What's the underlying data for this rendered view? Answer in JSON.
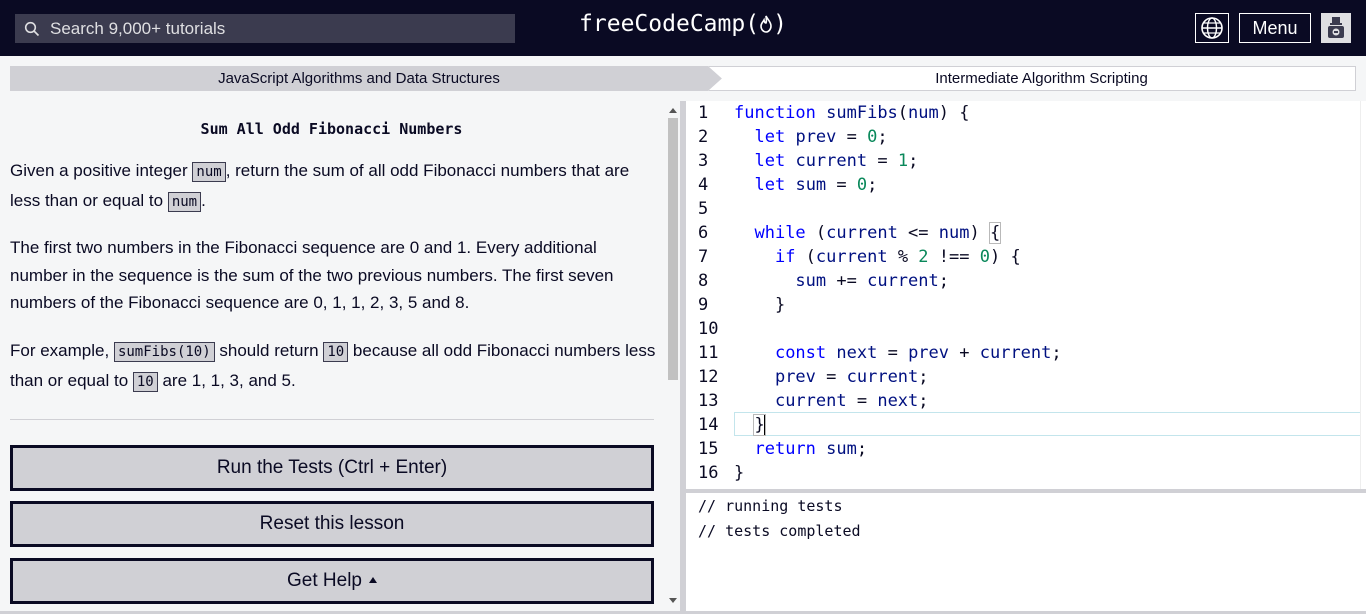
{
  "nav": {
    "search_placeholder": "Search 9,000+ tutorials",
    "brand": "freeCodeCamp(🔥)",
    "brand_text": "freeCodeCamp",
    "menu_label": "Menu",
    "globe_icon": "globe-icon",
    "avatar_icon": "user-avatar"
  },
  "breadcrumb": {
    "superblock": "JavaScript Algorithms and Data Structures",
    "block": "Intermediate Algorithm Scripting"
  },
  "challenge": {
    "title": "Sum All Odd Fibonacci Numbers",
    "p1_a": "Given a positive integer ",
    "p1_code1": "num",
    "p1_b": ", return the sum of all odd Fibonacci numbers that are less than or equal to ",
    "p1_code2": "num",
    "p1_c": ".",
    "p2": "The first two numbers in the Fibonacci sequence are 0 and 1. Every additional number in the sequence is the sum of the two previous numbers. The first seven numbers of the Fibonacci sequence are 0, 1, 1, 2, 3, 5 and 8.",
    "p3_a": "For example, ",
    "p3_code1": "sumFibs(10)",
    "p3_b": " should return ",
    "p3_code2": "10",
    "p3_c": " because all odd Fibonacci numbers less than or equal to ",
    "p3_code3": "10",
    "p3_d": " are 1, 1, 3, and 5."
  },
  "buttons": {
    "run": "Run the Tests (Ctrl + Enter)",
    "reset": "Reset this lesson",
    "help": "Get Help"
  },
  "editor": {
    "line_numbers": [
      "1",
      "2",
      "3",
      "4",
      "5",
      "6",
      "7",
      "8",
      "9",
      "10",
      "11",
      "12",
      "13",
      "14",
      "15",
      "16"
    ],
    "active_line": 14
  },
  "console": {
    "lines": [
      "// running tests",
      "// tests completed"
    ]
  },
  "colors": {
    "nav_bg": "#0a0a23",
    "keyword": "#0000ff",
    "number": "#09885a",
    "variable": "#001080",
    "button_bg": "#d0d0d5"
  }
}
